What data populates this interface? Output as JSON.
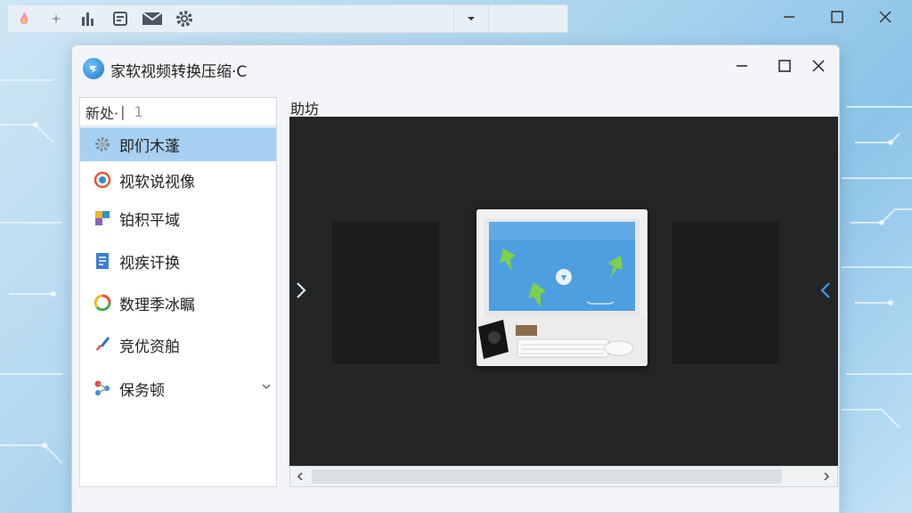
{
  "window": {
    "title": "家软视频转换压缩·C"
  },
  "sidebar": {
    "search_text": "新处·",
    "search_hint": "1",
    "items": [
      {
        "label": "即们木蓬",
        "icon": "gear-icon",
        "active": true
      },
      {
        "label": "视软说视像",
        "icon": "target-icon",
        "active": false
      },
      {
        "label": "铂积平域",
        "icon": "puzzle-icon",
        "active": false
      },
      {
        "label": "视疾讦换",
        "icon": "document-icon",
        "active": false
      },
      {
        "label": "数理季冰瞩",
        "icon": "refresh-icon",
        "active": false
      },
      {
        "label": "竞优资舶",
        "icon": "brush-icon",
        "active": false
      },
      {
        "label": "保务顿",
        "icon": "share-icon",
        "active": false
      }
    ]
  },
  "content": {
    "label": "助坊"
  },
  "colors": {
    "accent": "#a8d0f2",
    "viewer_bg": "#232526"
  }
}
